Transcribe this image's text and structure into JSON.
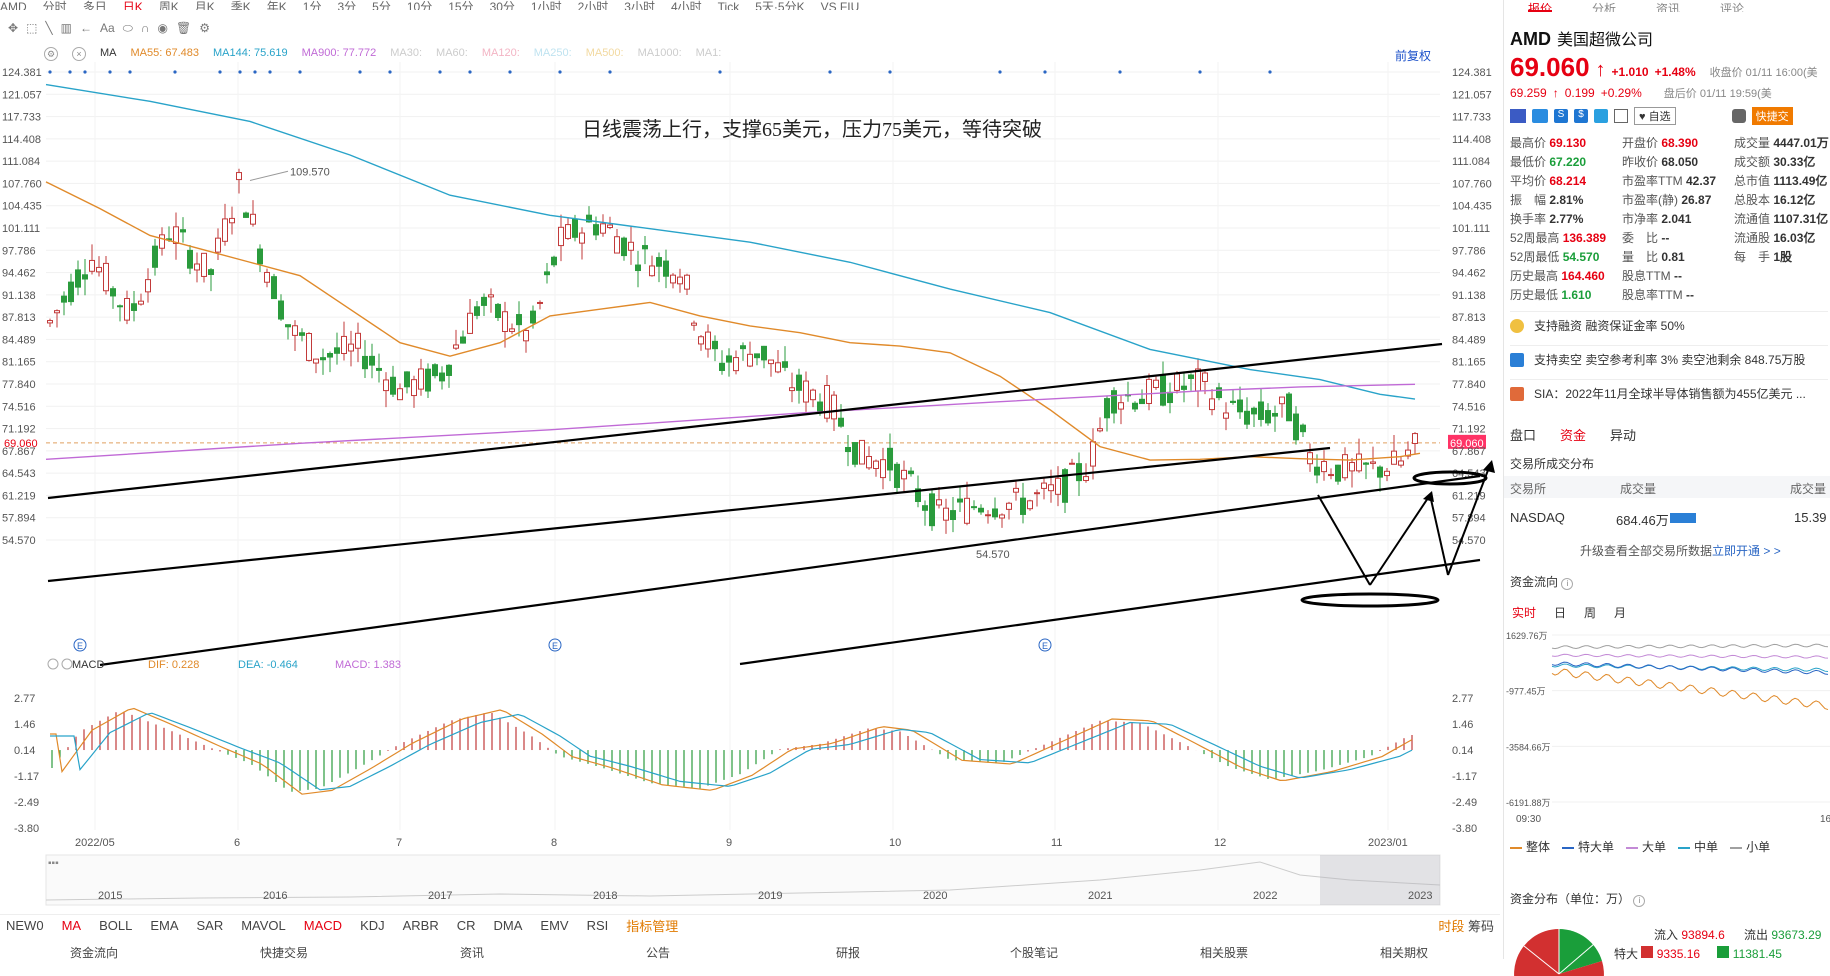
{
  "top_menu": [
    "AMD",
    "分时",
    "多日",
    "日K",
    "周K",
    "月K",
    "季K",
    "年K",
    "1分",
    "3分",
    "5分",
    "10分",
    "15分",
    "30分",
    "1小时",
    "2小时",
    "3小时",
    "4小时",
    "Tick",
    "5天·5分K",
    "VS FIU"
  ],
  "right_top_tabs": [
    "报价",
    "分析",
    "资讯",
    "评论"
  ],
  "display_label": "显示",
  "indicator_ma": {
    "name": "MA",
    "ma55": "MA55: 67.483",
    "ma144": "MA144: 75.619",
    "ma900": "MA900: 77.772",
    "extra": [
      "MA30:",
      "MA60:",
      "MA120:",
      "MA250:",
      "MA500:",
      "MA1000:",
      "MA1:"
    ]
  },
  "fuquan": "前复权",
  "headline": "日线震荡上行，支撑65美元，压力75美元，等待突破",
  "y_labels": [
    "124.381",
    "121.057",
    "117.733",
    "114.408",
    "111.084",
    "107.760",
    "104.435",
    "101.111",
    "97.786",
    "94.462",
    "91.138",
    "87.813",
    "84.489",
    "81.165",
    "77.840",
    "74.516",
    "71.192",
    "67.867",
    "64.543",
    "61.219",
    "57.894",
    "54.570"
  ],
  "current_price_line": "69.060",
  "annotations": {
    "high": "109.570",
    "low": "54.570"
  },
  "macd_header": {
    "name": "MACD",
    "dif": "DIF: 0.228",
    "dea": "DEA: -0.464",
    "macd": "MACD: 1.383"
  },
  "macd_labels": [
    "2.77",
    "1.46",
    "0.14",
    "-1.17",
    "-2.49",
    "-3.80"
  ],
  "x_labels": [
    "2022/05",
    "6",
    "7",
    "8",
    "9",
    "10",
    "11",
    "12",
    "2023/01"
  ],
  "overview_years": [
    "2015",
    "2016",
    "2017",
    "2018",
    "2019",
    "2020",
    "2021",
    "2022",
    "2023"
  ],
  "bottom_indicators": [
    "NEW0",
    "MA",
    "BOLL",
    "EMA",
    "SAR",
    "MAVOL",
    "MACD",
    "KDJ",
    "ARBR",
    "CR",
    "DMA",
    "EMV",
    "RSI",
    "指标管理"
  ],
  "bottom_right": [
    "时段",
    "筹码"
  ],
  "bottom_tabs": [
    "资金流向",
    "快捷交易",
    "资讯",
    "公告",
    "研报",
    "个股笔记",
    "相关股票",
    "相关期权"
  ],
  "stock": {
    "code": "AMD",
    "name": "美国超微公司",
    "price": "69.060",
    "arrow": "↑",
    "change": "+1.010",
    "pct": "+1.48%",
    "close_time": "收盘价 01/11 16:00(美",
    "after_price": "69.259",
    "after_arrow": "↑",
    "after_change": "0.199",
    "after_pct": "+0.29%",
    "after_time": "盘后价 01/11 19:59(美",
    "quick_trade": "快捷交",
    "self_select": "自选"
  },
  "stats": [
    [
      "最高价",
      "69.130",
      "red"
    ],
    [
      "开盘价",
      "68.390",
      "red"
    ],
    [
      "成交量",
      "4447.01万",
      ""
    ],
    [
      "最低价",
      "67.220",
      "green"
    ],
    [
      "昨收价",
      "68.050",
      ""
    ],
    [
      "成交额",
      "30.33亿",
      ""
    ],
    [
      "平均价",
      "68.214",
      "red"
    ],
    [
      "市盈率TTM",
      "42.37",
      ""
    ],
    [
      "总市值",
      "1113.49亿",
      ""
    ],
    [
      "振　幅",
      "2.81%",
      ""
    ],
    [
      "市盈率(静)",
      "26.87",
      ""
    ],
    [
      "总股本",
      "16.12亿",
      ""
    ],
    [
      "换手率",
      "2.77%",
      ""
    ],
    [
      "市净率",
      "2.041",
      ""
    ],
    [
      "流通值",
      "1107.31亿",
      ""
    ],
    [
      "52周最高",
      "136.389",
      "red"
    ],
    [
      "委　比",
      "--",
      ""
    ],
    [
      "流通股",
      "16.03亿",
      ""
    ],
    [
      "52周最低",
      "54.570",
      "green"
    ],
    [
      "量　比",
      "0.81",
      ""
    ],
    [
      "每　手",
      "1股",
      ""
    ],
    [
      "历史最高",
      "164.460",
      "red"
    ],
    [
      "股息TTM",
      "--",
      ""
    ],
    [
      "",
      "",
      " "
    ],
    [
      "历史最低",
      "1.610",
      "green"
    ],
    [
      "股息率TTM",
      "--",
      ""
    ],
    [
      "",
      "",
      " "
    ]
  ],
  "notices": [
    "支持融资 融资保证金率 50%",
    "支持卖空 卖空参考利率 3% 卖空池剩余 848.75万股",
    "SIA：2022年11月全球半导体销售额为455亿美元 ..."
  ],
  "sub_tabs": [
    "盘口",
    "资金",
    "异动"
  ],
  "exchange_title": "交易所成交分布",
  "exchange_headers": [
    "交易所",
    "成交量",
    "成交量"
  ],
  "exchange_row": {
    "name": "NASDAQ",
    "vol": "684.46万",
    "pct": "15.39"
  },
  "upgrade_text": "升级查看全部交易所数据",
  "upgrade_link": "立即开通 > >",
  "fund_flow_title": "资金流向",
  "fund_tabs": [
    "实时",
    "日",
    "周",
    "月"
  ],
  "fund_y": [
    "1629.76万",
    "-977.45万",
    "-3584.66万",
    "-6191.88万"
  ],
  "fund_x": [
    "09:30",
    "16"
  ],
  "fund_legend": [
    [
      "整体",
      "#e08a2a"
    ],
    [
      "特大单",
      "#2a66c4"
    ],
    [
      "大单",
      "#c38ad6"
    ],
    [
      "中单",
      "#29a3c9"
    ],
    [
      "小单",
      "#a0a0a0"
    ]
  ],
  "dist_title": "资金分布（单位：万）",
  "dist_in": "流入",
  "dist_in_val": "93894.6",
  "dist_out": "流出",
  "dist_out_val": "93673.29",
  "dist_in2": "9335.16",
  "dist_out2": "11381.45",
  "dist_big": "特大"
}
